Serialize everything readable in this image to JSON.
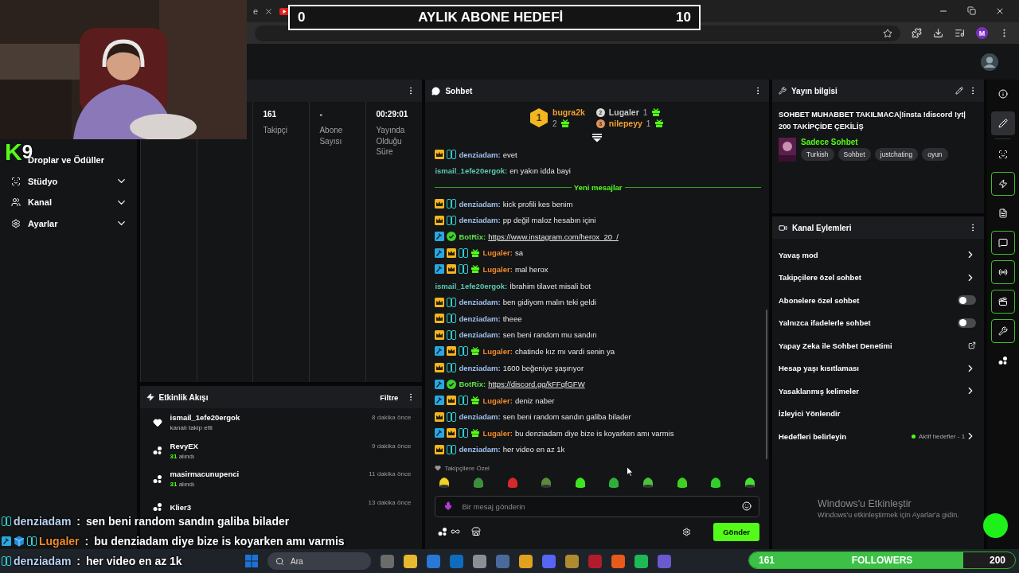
{
  "browser": {
    "tab_fragment": "e",
    "profile_initial": "M"
  },
  "goal": {
    "start": "0",
    "title": "AYLIK ABONE HEDEFİ",
    "end": "10"
  },
  "overlay_logo": {
    "letter": "K",
    "number": "9"
  },
  "sidebar": {
    "items": [
      {
        "label": "Droplar ve Ödüller",
        "kind": "link"
      },
      {
        "label": "Stüdyo",
        "kind": "group",
        "expanded": false
      },
      {
        "label": "Kanal",
        "kind": "group",
        "expanded": false
      },
      {
        "label": "Ayarlar",
        "kind": "group",
        "expanded": false
      }
    ]
  },
  "stats": [
    {
      "value": "161",
      "label": "Takipçi"
    },
    {
      "value": "-",
      "label": "Abone Sayısı"
    },
    {
      "value": "00:29:01",
      "label": "Yayında Olduğu Süre"
    }
  ],
  "activity": {
    "title": "Etkinlik Akışı",
    "filter": "Filtre",
    "items": [
      {
        "kind": "follow",
        "user": "ismail_1efe20ergok",
        "detail": "kanalı takip etti",
        "time": "8 dakika önce"
      },
      {
        "kind": "points",
        "user": "RevyEX",
        "amount": "31",
        "detail": "alındı",
        "time": "9 dakika önce"
      },
      {
        "kind": "points",
        "user": "masirmacunupenci",
        "amount": "31",
        "detail": "alındı",
        "time": "11 dakika önce"
      },
      {
        "kind": "points",
        "user": "Klier3",
        "time": "13 dakika önce"
      }
    ]
  },
  "chat": {
    "title": "Sohbet",
    "separator": ":",
    "leaderboard": [
      {
        "rank": "1",
        "user": "bugra2k",
        "count": "2",
        "color": "#f0a030"
      },
      {
        "rank": "2",
        "user": "Lugaler",
        "count": "1",
        "color": "#c8c8c8"
      },
      {
        "rank": "3",
        "user": "nilepeyy",
        "count": "1",
        "color": "#f0a030"
      }
    ],
    "messages": [
      {
        "kind": "message",
        "badges": {
          "crown": true,
          "og": true
        },
        "user": "denziadam",
        "color": "#9fc1ef",
        "text": "evet"
      },
      {
        "kind": "message",
        "user": "ismail_1efe20ergok",
        "color": "#5ec8b0",
        "text": "en yakın idda bayi"
      },
      {
        "kind": "divider",
        "text": "Yeni mesajlar"
      },
      {
        "kind": "message",
        "badges": {
          "crown": true,
          "og": true
        },
        "user": "denziadam",
        "color": "#9fc1ef",
        "text": "kick profili kes benim"
      },
      {
        "kind": "message",
        "badges": {
          "crown": true,
          "og": true
        },
        "user": "denziadam",
        "color": "#9fc1ef",
        "text": "pp değil maloz hesabın içini"
      },
      {
        "kind": "link",
        "badges": {
          "mod": true,
          "verified": true
        },
        "user": "BotRix",
        "color": "#5ee04a",
        "text": "https://www.instagram.com/herox_20_/"
      },
      {
        "kind": "message",
        "badges": {
          "mod": true,
          "crown": true,
          "og": true,
          "gifter": true
        },
        "user": "Lugaler",
        "color": "#f08a2c",
        "text": "sa"
      },
      {
        "kind": "message",
        "badges": {
          "mod": true,
          "crown": true,
          "og": true,
          "gifter": true
        },
        "user": "Lugaler",
        "color": "#f08a2c",
        "text": "mal herox"
      },
      {
        "kind": "message",
        "user": "ismail_1efe20ergok",
        "color": "#5ec8b0",
        "text": "İbrahim tilavet misali bot"
      },
      {
        "kind": "message",
        "badges": {
          "crown": true,
          "og": true
        },
        "user": "denziadam",
        "color": "#9fc1ef",
        "text": "ben gidiyom malın teki geldi"
      },
      {
        "kind": "message",
        "badges": {
          "crown": true,
          "og": true
        },
        "user": "denziadam",
        "color": "#9fc1ef",
        "text": "theee"
      },
      {
        "kind": "message",
        "badges": {
          "crown": true,
          "og": true
        },
        "user": "denziadam",
        "color": "#9fc1ef",
        "text": "sen beni random mu sandın"
      },
      {
        "kind": "message",
        "badges": {
          "mod": true,
          "crown": true,
          "og": true,
          "gifter": true
        },
        "user": "Lugaler",
        "color": "#f08a2c",
        "text": "chatinde kız mı vardi senin ya"
      },
      {
        "kind": "message",
        "badges": {
          "crown": true,
          "og": true
        },
        "user": "denziadam",
        "color": "#9fc1ef",
        "text": "1600 beğeniye şaşırıyor"
      },
      {
        "kind": "link",
        "badges": {
          "mod": true,
          "verified": true
        },
        "user": "BotRix",
        "color": "#5ee04a",
        "text": "https://discord.gg/kFFqfGFW"
      },
      {
        "kind": "message",
        "badges": {
          "mod": true,
          "crown": true,
          "og": true,
          "gifter": true
        },
        "user": "Lugaler",
        "color": "#f08a2c",
        "text": "deniz naber"
      },
      {
        "kind": "message",
        "badges": {
          "crown": true,
          "og": true
        },
        "user": "denziadam",
        "color": "#9fc1ef",
        "text": "sen beni random sandın galiba bilader"
      },
      {
        "kind": "message",
        "badges": {
          "mod": true,
          "crown": true,
          "og": true,
          "gifter": true
        },
        "user": "Lugaler",
        "color": "#f08a2c",
        "text": "bu denziadam diye bize is koyarken amı varmis"
      },
      {
        "kind": "message",
        "badges": {
          "crown": true,
          "og": true
        },
        "user": "denziadam",
        "color": "#9fc1ef",
        "text": "her video en az 1k"
      }
    ],
    "emote_section": "Takipçilere Özel",
    "placeholder": "Bir mesaj gönderin",
    "send": "Gönder"
  },
  "stream_info": {
    "title": "Yayın bilgisi",
    "title_lines": [
      "SOHBET MUHABBET TAKILMACA|!insta !discord !yt|",
      "200 TAKİPÇİDE ÇEKİLİŞ"
    ],
    "category": "Sadece Sohbet",
    "tags": [
      "Turkish",
      "Sohbet",
      "justchating",
      "oyun"
    ]
  },
  "channel_actions": {
    "title": "Kanal Eylemleri",
    "items": [
      {
        "label": "Yavaş mod",
        "kind": "link"
      },
      {
        "label": "Takipçilere özel sohbet",
        "kind": "link"
      },
      {
        "label": "Abonelere özel sohbet",
        "kind": "toggle",
        "on": false
      },
      {
        "label": "Yalnızca ifadelerle sohbet",
        "kind": "toggle",
        "on": false
      },
      {
        "label": "Yapay Zeka ile Sohbet Denetimi",
        "kind": "external"
      },
      {
        "label": "Hesap yaşı kısıtlaması",
        "kind": "link"
      },
      {
        "label": "Yasaklanmış kelimeler",
        "kind": "link"
      },
      {
        "label": "İzleyici Yönlendir",
        "kind": "plain"
      },
      {
        "label": "Hedefleri belirleyin",
        "kind": "goal",
        "status": "Aktif hedefler - 1"
      }
    ]
  },
  "rail": [
    {
      "selected": false,
      "on": false
    },
    {
      "selected": true,
      "on": false
    },
    {
      "selected": false,
      "on": false
    },
    {
      "selected": false,
      "on": true
    },
    {
      "selected": false,
      "on": false
    },
    {
      "selected": false,
      "on": true
    },
    {
      "selected": false,
      "on": true
    },
    {
      "selected": false,
      "on": true
    },
    {
      "selected": false,
      "on": true
    },
    {
      "selected": false,
      "on": false
    }
  ],
  "watermark": {
    "title": "Windows'u Etkinleştir",
    "subtitle": "Windows'u etkinleştirmek için Ayarlar'a gidin."
  },
  "taskbar": {
    "search": "Ara"
  },
  "overlay_chat": {
    "separator": ":",
    "lines": [
      {
        "badges": {
          "og": true
        },
        "user": "denziadam",
        "color": "#b8d0f0",
        "text": "sen beni random sandın galiba bilader"
      },
      {
        "badges": {
          "mod": true,
          "cube": true,
          "og": true
        },
        "user": "Lugaler",
        "color": "#f08a2c",
        "text": "bu denziadam diye bize is koyarken amı varmis"
      },
      {
        "badges": {
          "og": true
        },
        "user": "denziadam",
        "color": "#b8d0f0",
        "text": "her video en az 1k"
      }
    ]
  },
  "followers_bar": {
    "current": "161",
    "label": "FOLLOWERS",
    "target": "200",
    "level": 0.805
  }
}
